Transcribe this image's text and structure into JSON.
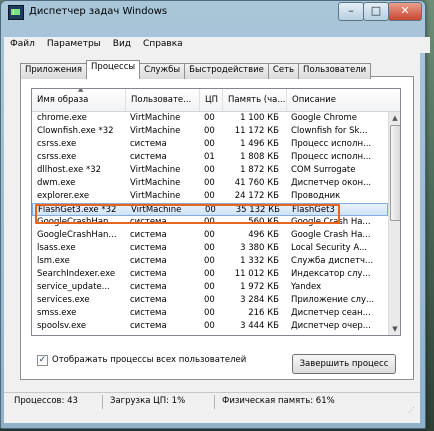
{
  "window": {
    "title": "Диспетчер задач Windows",
    "controls": {
      "minimize": "–",
      "maximize": "□",
      "close": "✕"
    }
  },
  "menu": [
    "Файл",
    "Параметры",
    "Вид",
    "Справка"
  ],
  "tabs": [
    "Приложения",
    "Процессы",
    "Службы",
    "Быстродействие",
    "Сеть",
    "Пользователи"
  ],
  "active_tab": "Процессы",
  "columns": [
    "Имя образа",
    "Пользовате...",
    "ЦП",
    "Память (ча...",
    "Описание"
  ],
  "sorted_column": "Имя образа",
  "processes": [
    {
      "name": "chrome.exe",
      "user": "VirtMachine",
      "cpu": "00",
      "mem": "1 100 КБ",
      "desc": "Google Chrome"
    },
    {
      "name": "Clownfish.exe *32",
      "user": "VirtMachine",
      "cpu": "00",
      "mem": "11 172 КБ",
      "desc": "Clownfish for Sk..."
    },
    {
      "name": "csrss.exe",
      "user": "система",
      "cpu": "00",
      "mem": "1 496 КБ",
      "desc": "Процесс исполн..."
    },
    {
      "name": "csrss.exe",
      "user": "система",
      "cpu": "01",
      "mem": "1 808 КБ",
      "desc": "Процесс исполн..."
    },
    {
      "name": "dllhost.exe *32",
      "user": "VirtMachine",
      "cpu": "00",
      "mem": "1 872 КБ",
      "desc": "COM Surrogate"
    },
    {
      "name": "dwm.exe",
      "user": "VirtMachine",
      "cpu": "00",
      "mem": "41 760 КБ",
      "desc": "Диспетчер окон..."
    },
    {
      "name": "explorer.exe",
      "user": "VirtMachine",
      "cpu": "00",
      "mem": "24 172 КБ",
      "desc": "Проводник"
    },
    {
      "name": "FlashGet3.exe *32",
      "user": "VirtMachine",
      "cpu": "00",
      "mem": "35 132 КБ",
      "desc": "FlashGet3"
    },
    {
      "name": "GoogleCrashHan...",
      "user": "система",
      "cpu": "00",
      "mem": "560 КБ",
      "desc": "Google Crash Ha..."
    },
    {
      "name": "GoogleCrashHan...",
      "user": "система",
      "cpu": "00",
      "mem": "496 КБ",
      "desc": "Google Crash Ha..."
    },
    {
      "name": "lsass.exe",
      "user": "система",
      "cpu": "00",
      "mem": "3 380 КБ",
      "desc": "Local Security A..."
    },
    {
      "name": "lsm.exe",
      "user": "система",
      "cpu": "00",
      "mem": "1 332 КБ",
      "desc": "Служба диспетч..."
    },
    {
      "name": "SearchIndexer.exe",
      "user": "система",
      "cpu": "00",
      "mem": "11 012 КБ",
      "desc": "Индексатор слу..."
    },
    {
      "name": "service_update...",
      "user": "система",
      "cpu": "00",
      "mem": "1 972 КБ",
      "desc": "Yandex"
    },
    {
      "name": "services.exe",
      "user": "система",
      "cpu": "00",
      "mem": "3 284 КБ",
      "desc": "Приложение слу..."
    },
    {
      "name": "smss.exe",
      "user": "система",
      "cpu": "00",
      "mem": "216 КБ",
      "desc": "Диспетчер сеан..."
    },
    {
      "name": "spoolsv.exe",
      "user": "система",
      "cpu": "00",
      "mem": "3 444 КБ",
      "desc": "Диспетчер очер..."
    }
  ],
  "selected_process": "FlashGet3.exe *32",
  "show_all_checkbox": {
    "label": "Отображать процессы всех пользователей",
    "checked": true
  },
  "end_process_button": "Завершить процесс",
  "status": {
    "processes": "Процессов: 43",
    "cpu": "Загрузка ЦП: 1%",
    "memory": "Физическая память: 61%"
  },
  "colors": {
    "highlight": "#e8651f",
    "selection": "#cfe3f8"
  }
}
